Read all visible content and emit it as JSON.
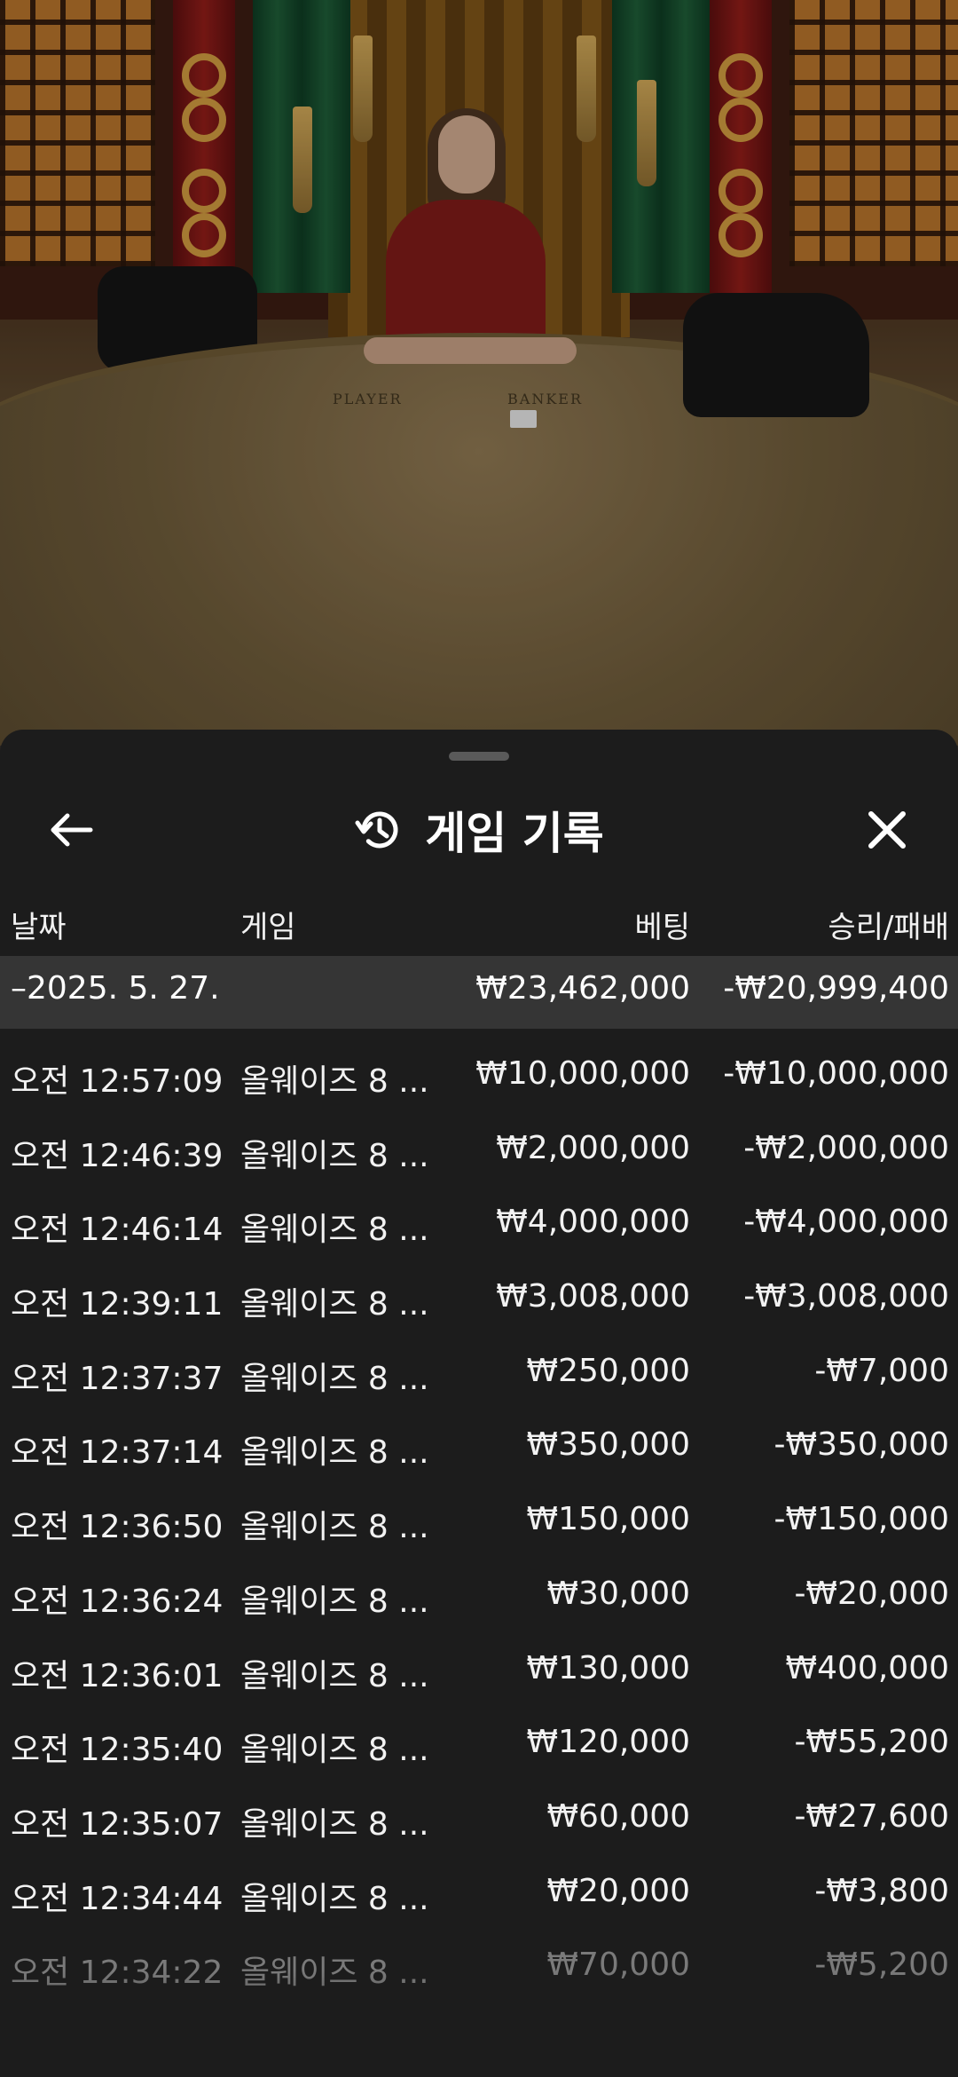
{
  "header": {
    "title": "게임 기록",
    "back_icon": "arrow-left-icon",
    "history_icon": "history-icon",
    "close_icon": "close-icon"
  },
  "background": {
    "table_labels": [
      "PLAYER",
      "BANKER"
    ]
  },
  "table": {
    "columns": [
      "날짜",
      "게임",
      "베팅",
      "승리/패배"
    ],
    "summary": {
      "date": "–2025. 5. 27.",
      "game": "",
      "bet": "₩23,462,000",
      "result": "-₩20,999,400"
    },
    "rows": [
      {
        "time": "오전 12:57:09",
        "game": "올웨이즈 8 ...",
        "bet": "₩10,000,000",
        "result": "-₩10,000,000"
      },
      {
        "time": "오전 12:46:39",
        "game": "올웨이즈 8 ...",
        "bet": "₩2,000,000",
        "result": "-₩2,000,000"
      },
      {
        "time": "오전 12:46:14",
        "game": "올웨이즈 8 ...",
        "bet": "₩4,000,000",
        "result": "-₩4,000,000"
      },
      {
        "time": "오전 12:39:11",
        "game": "올웨이즈 8 ...",
        "bet": "₩3,008,000",
        "result": "-₩3,008,000"
      },
      {
        "time": "오전 12:37:37",
        "game": "올웨이즈 8 ...",
        "bet": "₩250,000",
        "result": "-₩7,000"
      },
      {
        "time": "오전 12:37:14",
        "game": "올웨이즈 8 ...",
        "bet": "₩350,000",
        "result": "-₩350,000"
      },
      {
        "time": "오전 12:36:50",
        "game": "올웨이즈 8 ...",
        "bet": "₩150,000",
        "result": "-₩150,000"
      },
      {
        "time": "오전 12:36:24",
        "game": "올웨이즈 8 ...",
        "bet": "₩30,000",
        "result": "-₩20,000"
      },
      {
        "time": "오전 12:36:01",
        "game": "올웨이즈 8 ...",
        "bet": "₩130,000",
        "result": "₩400,000"
      },
      {
        "time": "오전 12:35:40",
        "game": "올웨이즈 8 ...",
        "bet": "₩120,000",
        "result": "-₩55,200"
      },
      {
        "time": "오전 12:35:07",
        "game": "올웨이즈 8 ...",
        "bet": "₩60,000",
        "result": "-₩27,600"
      },
      {
        "time": "오전 12:34:44",
        "game": "올웨이즈 8 ...",
        "bet": "₩20,000",
        "result": "-₩3,800"
      },
      {
        "time": "오전 12:34:22",
        "game": "올웨이즈 8 ...",
        "bet": "₩70,000",
        "result": "-₩5,200"
      }
    ]
  }
}
